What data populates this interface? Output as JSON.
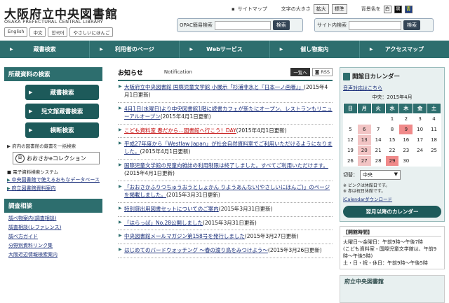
{
  "header": {
    "logo_jp": "大阪府立中央図書館",
    "logo_en": "OSAKA PREFECTURAL CENTRAL LIBRARY",
    "languages": [
      "English",
      "中文",
      "한국어",
      "やさしいにほんご"
    ],
    "sitemap": "サイトマップ",
    "text_size_label": "文字の大きさ",
    "enlarge": "拡大",
    "standard": "標準",
    "bg_color_label": "背景色を",
    "bg_white": "白",
    "bg_black": "黒",
    "bg_blue": "青",
    "opac_label": "OPAC簡易検索",
    "opac_button": "検索",
    "site_search_label": "サイト内検索",
    "site_search_button": "検索"
  },
  "nav": [
    "蔵書検索",
    "利用者のページ",
    "Webサービス",
    "催し物案内",
    "アクセスマップ"
  ],
  "left": {
    "heading": "所蔵資料の検索",
    "buttons": [
      "蔵書検索",
      "児文館蔵書検索",
      "横断検索"
    ],
    "note": "▶ 府内の図書館の蔵書を一括検索",
    "ecollection": "おおさかeコレクション",
    "ecol_icon_text": "大阪府立図書館",
    "elec_label": "■ 電子資料検索システム",
    "links": [
      "中央図書館で使えるおもなデータベース",
      "府立図書館資料案内"
    ],
    "heading2": "調査相談",
    "sublinks": [
      "調べ物案内(調査相談)",
      "調査相談(レファレンス)",
      "調べ方ガイド",
      "分野別資料リンク集",
      "大阪近辺情報検索案内"
    ]
  },
  "main": {
    "title": "お知らせ",
    "title_en": "Notification",
    "list_btn": "一覧へ",
    "rss": "RSS",
    "news": [
      {
        "link": "大阪府立中央図書館 国際児童文学館 小展示「杉浦非水と『日本一ノ画噺』」",
        "date": "(2015年4月1日更新)"
      },
      {
        "link": "4月1日(水曜日)より中央図書館1階に読書カフェが新たにオープン、レストランもリニューアルオープン",
        "date": "(2015年4月1日更新)"
      },
      {
        "link": "こども資料室 春だから…図書館へ行こう！DAY",
        "date": "(2015年4月1日更新)"
      },
      {
        "link": "平成27年度から「Westlaw Japan」が社会自然資料室でご利用いただけるようになりました。",
        "date": "(2015年4月1日更新)"
      },
      {
        "link": "国際児童文学館の児童向雑誌の利用制限は終了しました。すべてご利用いただけます。",
        "date": "(2015年4月1日更新)"
      },
      {
        "link": "「おおさかふりつちゅうおうとしょかん りようあんない(やさしいにほんご)」のページを掲載しました。",
        "date": "(2015年3月31日更新)"
      },
      {
        "link": "特別貸出用図書セットについてのご案内",
        "date": "(2015年3月31日更新)"
      },
      {
        "link": "「はらっぱ」No.28公開しました",
        "date": "(2015年3月31日更新)"
      },
      {
        "link": "中央図書館メールマガジン第158号を発行しました",
        "date": "(2015年3月27日更新)"
      },
      {
        "link": "はじめてのバードウォッチング ～春の渡り鳥をみつけよう～",
        "date": "(2015年3月26日更新)"
      }
    ]
  },
  "calendar": {
    "title": "開館日カレンダー",
    "audio_link": "音声対応はこちら",
    "month": "中央：2015年4月",
    "weekdays": [
      "日",
      "月",
      "火",
      "水",
      "木",
      "金",
      "土"
    ],
    "rows": [
      [
        "",
        "",
        "",
        "1",
        "2",
        "3",
        "4"
      ],
      [
        "5",
        "6",
        "7",
        "8",
        "9",
        "10",
        "11"
      ],
      [
        "12",
        "13",
        "14",
        "15",
        "16",
        "17",
        "18"
      ],
      [
        "19",
        "20",
        "21",
        "22",
        "23",
        "24",
        "25"
      ],
      [
        "26",
        "27",
        "28",
        "29",
        "30",
        "",
        ""
      ]
    ],
    "switch_label": "切替：",
    "switch_value": "中央",
    "note1": "※ ピンクは休館日です。",
    "note2": "※ 赤は祝日休館です。",
    "ical": "iCalendarダウンロード",
    "next_btn": "翌月以降のカレンダー",
    "hours_title": "【開館時間】",
    "hours": [
      "火曜日～金曜日：午前9時～午後7時",
      "(こども資料室・国際児童文学館は、午前9時～午後5時)",
      "土・日・祝・休日：午前9時～午後5時"
    ],
    "banner": "府立中央図書館"
  },
  "colors": {
    "primary": "#2d6e6e",
    "link": "#1a2f7a",
    "highlight": "#c00000",
    "holiday": "#f2c4c4"
  }
}
